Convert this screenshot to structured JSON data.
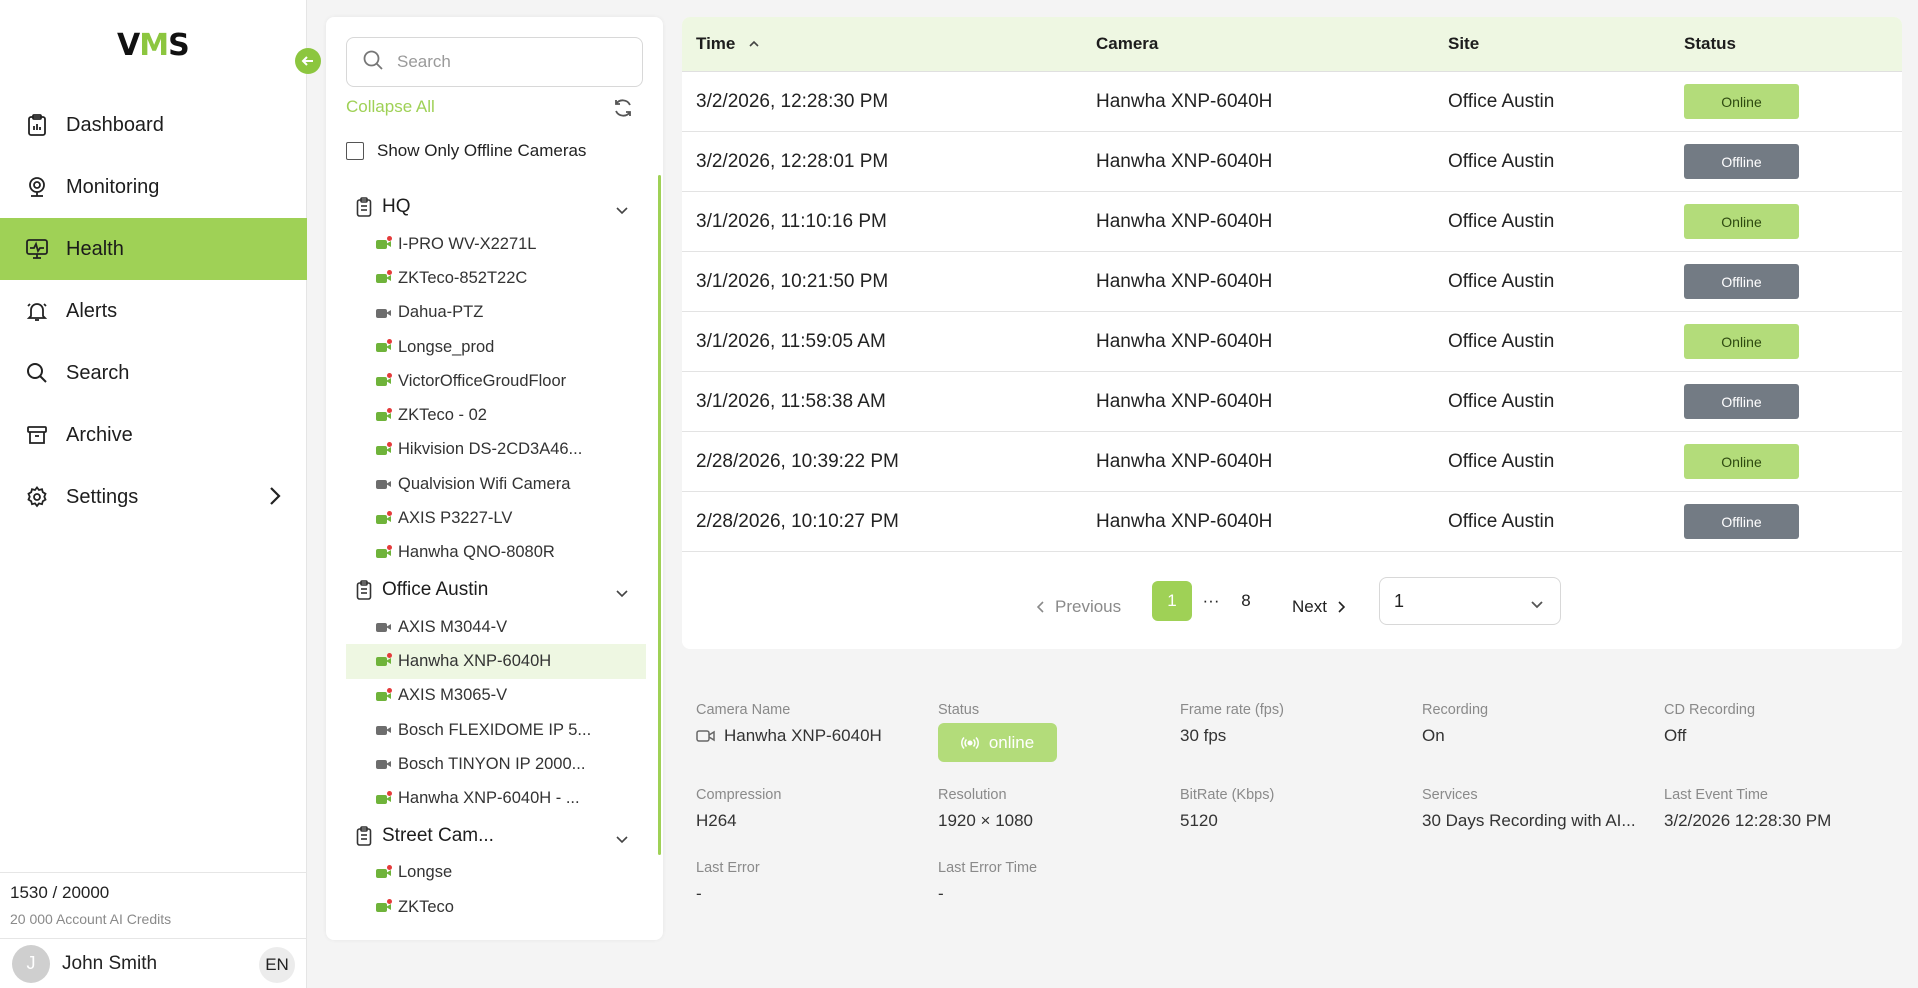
{
  "sidebar": {
    "logo": {
      "left": "V",
      "mid": "M",
      "right": "S"
    },
    "nav": [
      {
        "label": "Dashboard",
        "icon": "dashboard-icon"
      },
      {
        "label": "Monitoring",
        "icon": "monitoring-icon"
      },
      {
        "label": "Health",
        "icon": "health-icon",
        "active": true
      },
      {
        "label": "Alerts",
        "icon": "alerts-icon"
      },
      {
        "label": "Search",
        "icon": "search-icon"
      },
      {
        "label": "Archive",
        "icon": "archive-icon"
      },
      {
        "label": "Settings",
        "icon": "settings-icon"
      }
    ],
    "credits": {
      "value": "1530 / 20000",
      "label": "20 000 Account AI Credits"
    },
    "user": {
      "initial": "J",
      "name": "John Smith",
      "lang": "EN"
    }
  },
  "tree": {
    "search_placeholder": "Search",
    "collapse_all": "Collapse All",
    "offline_only": "Show Only Offline Cameras",
    "sites": [
      {
        "name": "HQ",
        "cameras": [
          {
            "name": "I-PRO WV-X2271L",
            "on": true,
            "alert": true
          },
          {
            "name": "ZKTeco-852T22C",
            "on": true,
            "alert": true
          },
          {
            "name": "Dahua-PTZ",
            "on": false,
            "alert": false
          },
          {
            "name": "Longse_prod",
            "on": true,
            "alert": true
          },
          {
            "name": "VictorOfficeGroudFloor",
            "on": true,
            "alert": true
          },
          {
            "name": "ZKTeco - 02",
            "on": true,
            "alert": true
          },
          {
            "name": "Hikvision DS-2CD3A46...",
            "on": true,
            "alert": true
          },
          {
            "name": "Qualvision Wifi Camera",
            "on": false,
            "alert": false
          },
          {
            "name": "AXIS P3227-LV",
            "on": true,
            "alert": true
          },
          {
            "name": "Hanwha QNO-8080R",
            "on": true,
            "alert": true
          }
        ]
      },
      {
        "name": "Office Austin",
        "cameras": [
          {
            "name": "AXIS M3044-V",
            "on": false,
            "alert": false
          },
          {
            "name": "Hanwha XNP-6040H",
            "on": true,
            "alert": true,
            "selected": true
          },
          {
            "name": "AXIS M3065-V",
            "on": true,
            "alert": true
          },
          {
            "name": "Bosch FLEXIDOME IP 5...",
            "on": false,
            "alert": false
          },
          {
            "name": "Bosch TINYON IP 2000...",
            "on": false,
            "alert": false
          },
          {
            "name": "Hanwha XNP-6040H - ...",
            "on": true,
            "alert": true
          }
        ]
      },
      {
        "name": "Street Cam...",
        "cameras": [
          {
            "name": "Longse",
            "on": true,
            "alert": true
          },
          {
            "name": "ZKTeco",
            "on": true,
            "alert": true
          }
        ]
      }
    ]
  },
  "table": {
    "headers": {
      "time": "Time",
      "camera": "Camera",
      "site": "Site",
      "status": "Status"
    },
    "rows": [
      {
        "time": "3/2/2026, 12:28:30 PM",
        "camera": "Hanwha XNP-6040H",
        "site": "Office Austin",
        "status": "Online"
      },
      {
        "time": "3/2/2026, 12:28:01 PM",
        "camera": "Hanwha XNP-6040H",
        "site": "Office Austin",
        "status": "Offline"
      },
      {
        "time": "3/1/2026, 11:10:16 PM",
        "camera": "Hanwha XNP-6040H",
        "site": "Office Austin",
        "status": "Online"
      },
      {
        "time": "3/1/2026, 10:21:50 PM",
        "camera": "Hanwha XNP-6040H",
        "site": "Office Austin",
        "status": "Offline"
      },
      {
        "time": "3/1/2026, 11:59:05 AM",
        "camera": "Hanwha XNP-6040H",
        "site": "Office Austin",
        "status": "Online"
      },
      {
        "time": "3/1/2026, 11:58:38 AM",
        "camera": "Hanwha XNP-6040H",
        "site": "Office Austin",
        "status": "Offline"
      },
      {
        "time": "2/28/2026, 10:39:22 PM",
        "camera": "Hanwha XNP-6040H",
        "site": "Office Austin",
        "status": "Online"
      },
      {
        "time": "2/28/2026, 10:10:27 PM",
        "camera": "Hanwha XNP-6040H",
        "site": "Office Austin",
        "status": "Offline"
      }
    ],
    "pagination": {
      "previous": "Previous",
      "current": "1",
      "dots": "···",
      "last": "8",
      "next": "Next",
      "page_select": "1"
    }
  },
  "details": {
    "camera_name": {
      "label": "Camera Name",
      "value": "Hanwha XNP-6040H"
    },
    "status": {
      "label": "Status",
      "value": "online"
    },
    "frame_rate": {
      "label": "Frame rate (fps)",
      "value": "30 fps"
    },
    "recording": {
      "label": "Recording",
      "value": "On"
    },
    "cd_recording": {
      "label": "CD Recording",
      "value": "Off"
    },
    "compression": {
      "label": "Compression",
      "value": "H264"
    },
    "resolution": {
      "label": "Resolution",
      "value": "1920 × 1080"
    },
    "bitrate": {
      "label": "BitRate (Kbps)",
      "value": "5120"
    },
    "services": {
      "label": "Services",
      "value": "30 Days Recording with AI..."
    },
    "last_event": {
      "label": "Last Event Time",
      "value": "3/2/2026 12:28:30 PM"
    },
    "last_error": {
      "label": "Last Error",
      "value": "-"
    },
    "last_error_time": {
      "label": "Last Error Time",
      "value": "-"
    }
  },
  "colors": {
    "accent": "#9fd156",
    "online": "#b3dc7a",
    "offline": "#737b84",
    "header_bg": "#eef7e2"
  }
}
